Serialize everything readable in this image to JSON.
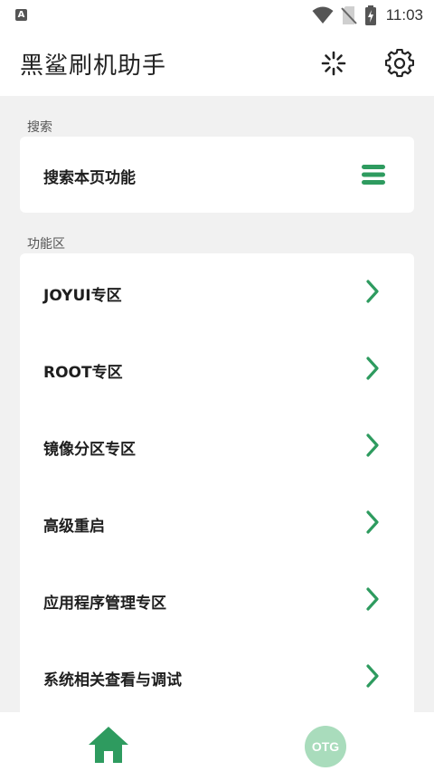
{
  "status_bar": {
    "time": "11:03",
    "icons": [
      "notification-a-icon",
      "wifi-icon",
      "no-sim-icon",
      "battery-charging-icon"
    ]
  },
  "app_bar": {
    "title": "黑鲨刷机助手",
    "icons": [
      "loading-spinner-icon",
      "settings-gear-icon"
    ]
  },
  "search_section": {
    "header": "搜索",
    "item_label": "搜索本页功能",
    "icon": "menu-list-icon"
  },
  "function_section": {
    "header": "功能区",
    "items": [
      {
        "label": "JOYUI专区"
      },
      {
        "label": "ROOT专区"
      },
      {
        "label": "镜像分区专区"
      },
      {
        "label": "高级重启"
      },
      {
        "label": "应用程序管理专区"
      },
      {
        "label": "系统相关查看与调试"
      }
    ]
  },
  "bottom_nav": {
    "home_icon": "home-icon",
    "otg_label": "OTG"
  },
  "colors": {
    "accent": "#2e9b5f",
    "otg_badge": "#a9dcbc",
    "background": "#f1f1f1"
  }
}
